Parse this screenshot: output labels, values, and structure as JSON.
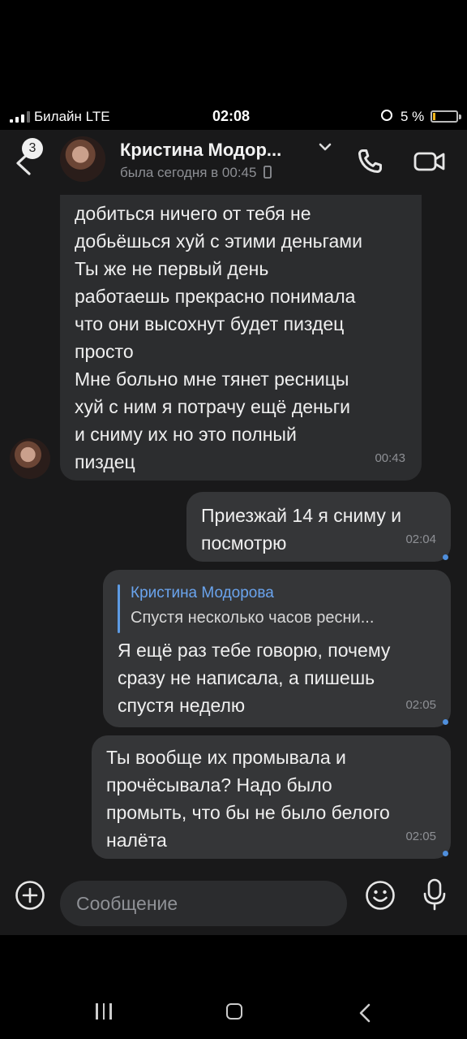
{
  "status_bar": {
    "carrier": "Билайн  LTE",
    "time": "02:08",
    "battery": "5 %",
    "battery_level": 0.05
  },
  "header": {
    "unread_count": "3",
    "contact_name": "Кристина Модор...",
    "last_seen": "была сегодня в 00:45",
    "icons": [
      "back-arrow-icon",
      "chevron-down-icon",
      "phone-icon",
      "video-camera-icon",
      "mobile-device-icon"
    ]
  },
  "messages": [
    {
      "direction": "incoming",
      "text": "добиться ничего от тебя не\nдобьёшься хуй с этими деньгами\nТы же не первый день\nработаешь прекрасно понимала\nчто они высохнут будет пиздец\nпросто\nМне больно мне тянет ресницы\nхуй с ним я потрачу ещё деньги\nи сниму их но это полный\nпиздец",
      "time": "00:43"
    },
    {
      "direction": "outgoing",
      "text": "Приезжай 14 я сниму и\nпосмотрю",
      "time": "02:04"
    },
    {
      "direction": "outgoing",
      "reply_to": {
        "author": "Кристина Модорова",
        "text": "Спустя несколько часов ресни..."
      },
      "text": "Я ещё раз тебе говорю, почему\nсразу не написала, а пишешь\nспустя неделю",
      "time": "02:05"
    },
    {
      "direction": "outgoing",
      "text": "Ты вообще их промывала и\nпрочёсывала? Надо было\nпромыть, что бы не было белого\nналёта",
      "time": "02:05"
    }
  ],
  "composer": {
    "placeholder": "Сообщение",
    "icons": [
      "add-icon",
      "emoji-icon",
      "microphone-icon"
    ]
  },
  "nav_bar": {
    "icons": [
      "recent-apps-icon",
      "home-icon",
      "back-icon"
    ]
  },
  "colors": {
    "background": "#19191a",
    "bubble_in": "#2c2d2f",
    "bubble_out": "#353638",
    "accent": "#4f8fdc"
  }
}
